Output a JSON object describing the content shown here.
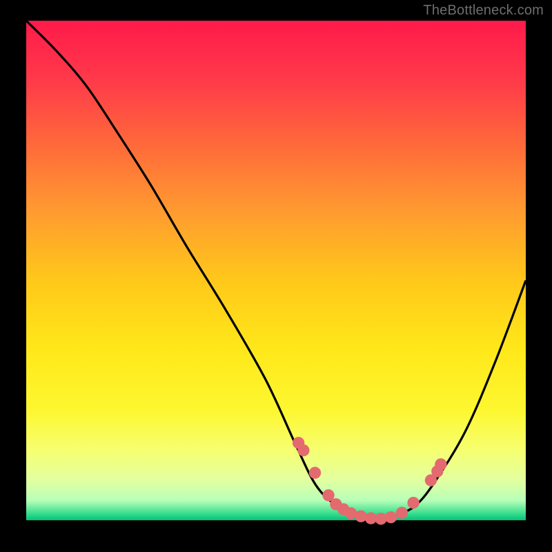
{
  "watermark": "TheBottleneck.com",
  "chart_data": {
    "type": "line",
    "title": "",
    "xlabel": "",
    "ylabel": "",
    "xlim": [
      0,
      100
    ],
    "ylim": [
      0,
      100
    ],
    "grid": false,
    "series": [
      {
        "name": "bottleneck-curve",
        "x": [
          0,
          6,
          12,
          18,
          25,
          32,
          40,
          48,
          54,
          58,
          62,
          66,
          70,
          74,
          78,
          82,
          88,
          94,
          100
        ],
        "values": [
          100,
          94,
          87,
          78,
          67,
          55,
          42,
          28,
          15,
          7,
          3,
          1,
          0,
          1,
          3,
          8,
          18,
          32,
          48
        ]
      }
    ],
    "markers": {
      "name": "sample-points",
      "color": "#e36a6f",
      "radius_frac": 0.012,
      "x": [
        54.5,
        55.5,
        57.8,
        60.5,
        62.0,
        63.5,
        65.0,
        67.0,
        69.0,
        71.0,
        73.0,
        75.2,
        77.5,
        81.0,
        82.3,
        83.0
      ],
      "values": [
        15.5,
        14.0,
        9.5,
        5.0,
        3.2,
        2.2,
        1.4,
        0.8,
        0.4,
        0.3,
        0.6,
        1.5,
        3.5,
        8.0,
        9.8,
        11.2
      ]
    },
    "background_gradient": {
      "top": "#ff1a4a",
      "mid": "#ffe81a",
      "bottom": "#00c27a"
    }
  }
}
